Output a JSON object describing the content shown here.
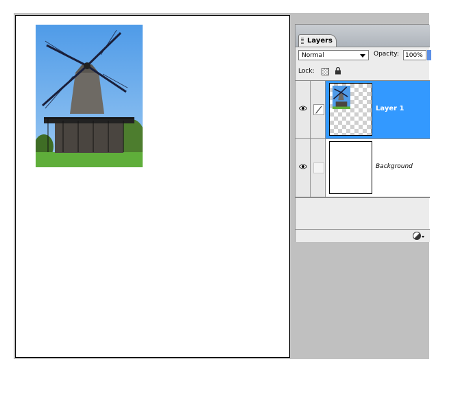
{
  "document": {
    "image_name": "windmill-photo"
  },
  "layers_panel": {
    "tab_label": "Layers",
    "blend_mode": "Normal",
    "opacity_label": "Opacity:",
    "opacity_value": "100%",
    "lock_label": "Lock:",
    "layers": [
      {
        "name": "Layer 1",
        "selected": true,
        "visible": true
      },
      {
        "name": "Background",
        "selected": false,
        "visible": true
      }
    ]
  },
  "colors": {
    "selection": "#3399ff",
    "workspace": "#c0c0c0"
  }
}
